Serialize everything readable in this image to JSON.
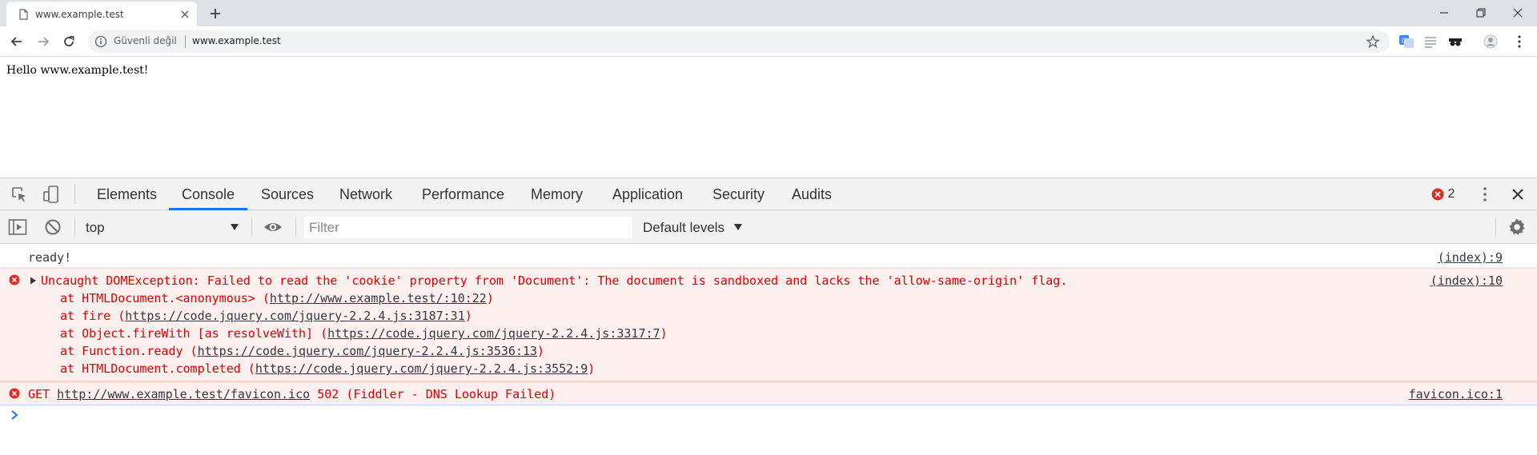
{
  "browser": {
    "tab_title": "www.example.test",
    "insecure_label": "Güvenli değil",
    "url": "www.example.test"
  },
  "page": {
    "text": "Hello www.example.test!"
  },
  "devtools": {
    "tabs": [
      "Elements",
      "Console",
      "Sources",
      "Network",
      "Performance",
      "Memory",
      "Application",
      "Security",
      "Audits"
    ],
    "active_tab": "Console",
    "error_count": "2",
    "context": "top",
    "filter_placeholder": "Filter",
    "levels": "Default levels"
  },
  "console": {
    "log": {
      "text": "ready!",
      "source": "(index):9"
    },
    "error1": {
      "message": "Uncaught DOMException: Failed to read the 'cookie' property from 'Document': The document is sandboxed and lacks the 'allow-same-origin' flag.",
      "source": "(index):10",
      "stack": [
        {
          "prefix": "at HTMLDocument.<anonymous> (",
          "link": "http://www.example.test/:10:22",
          "suffix": ")"
        },
        {
          "prefix": "at fire (",
          "link": "https://code.jquery.com/jquery-2.2.4.js:3187:31",
          "suffix": ")"
        },
        {
          "prefix": "at Object.fireWith [as resolveWith] (",
          "link": "https://code.jquery.com/jquery-2.2.4.js:3317:7",
          "suffix": ")"
        },
        {
          "prefix": "at Function.ready (",
          "link": "https://code.jquery.com/jquery-2.2.4.js:3536:13",
          "suffix": ")"
        },
        {
          "prefix": "at HTMLDocument.completed (",
          "link": "https://code.jquery.com/jquery-2.2.4.js:3552:9",
          "suffix": ")"
        }
      ]
    },
    "error2": {
      "method": "GET",
      "url": "http://www.example.test/favicon.ico",
      "status": "502 (Fiddler - DNS Lookup Failed)",
      "source": "favicon.ico:1"
    }
  },
  "colors": {
    "accent": "#1a73e8",
    "error_text": "#dd0000",
    "error_bg": "#fff0f0",
    "error_icon": "#d93025"
  }
}
